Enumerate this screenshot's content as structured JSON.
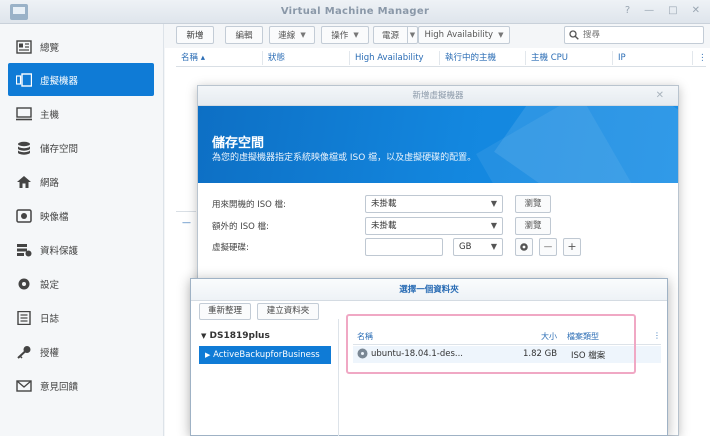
{
  "window": {
    "title": "Virtual Machine Manager",
    "controls": [
      "?",
      "—",
      "□",
      "✕"
    ]
  },
  "sidebar": {
    "items": [
      {
        "label": "總覽",
        "icon": "overview-icon"
      },
      {
        "label": "虛擬機器",
        "icon": "vm-icon",
        "active": true
      },
      {
        "label": "主機",
        "icon": "host-icon"
      },
      {
        "label": "儲存空間",
        "icon": "storage-icon"
      },
      {
        "label": "網路",
        "icon": "network-icon"
      },
      {
        "label": "映像檔",
        "icon": "image-icon"
      },
      {
        "label": "資料保護",
        "icon": "data-protection-icon"
      },
      {
        "label": "設定",
        "icon": "gear-icon"
      },
      {
        "label": "日誌",
        "icon": "log-icon"
      },
      {
        "label": "授權",
        "icon": "key-icon"
      },
      {
        "label": "意見回饋",
        "icon": "mail-icon"
      }
    ]
  },
  "toolbar": {
    "new_label": "新增",
    "edit_label": "編輯",
    "connect_label": "連線",
    "action_label": "操作",
    "power_label": "電源",
    "ha_label": "High Availability",
    "search_placeholder": "搜尋"
  },
  "table": {
    "columns": [
      "名稱 ▴",
      "狀態",
      "High Availability",
      "執行中的主機",
      "主機 CPU",
      "IP"
    ]
  },
  "dialog_new_vm": {
    "title": "新增虛擬機器",
    "banner_title": "儲存空間",
    "banner_desc": "為您的虛擬機器指定系統映像檔或 ISO 檔，以及虛擬硬碟的配置。",
    "boot_iso_label": "用來開機的 ISO 檔:",
    "boot_iso_value": "未掛載",
    "extra_iso_label": "額外的 ISO 檔:",
    "extra_iso_value": "未掛載",
    "disk_label": "虛擬硬碟:",
    "disk_unit": "GB",
    "browse_label": "瀏覽",
    "minus_label": "—",
    "plus_label": "+"
  },
  "dialog_folder": {
    "title": "選擇一個資料夾",
    "refresh_label": "重新整理",
    "new_folder_label": "建立資料夾",
    "tree_root": "DS1819plus",
    "tree_selected": "ActiveBackupforBusiness",
    "col_name": "名稱",
    "col_size": "大小",
    "col_type": "檔案類型",
    "file_name": "ubuntu-18.04.1-des...",
    "file_size": "1.82 GB",
    "file_type": "ISO 檔案"
  },
  "colors": {
    "accent": "#0f7bd6",
    "highlight": "#f0a8c4"
  }
}
